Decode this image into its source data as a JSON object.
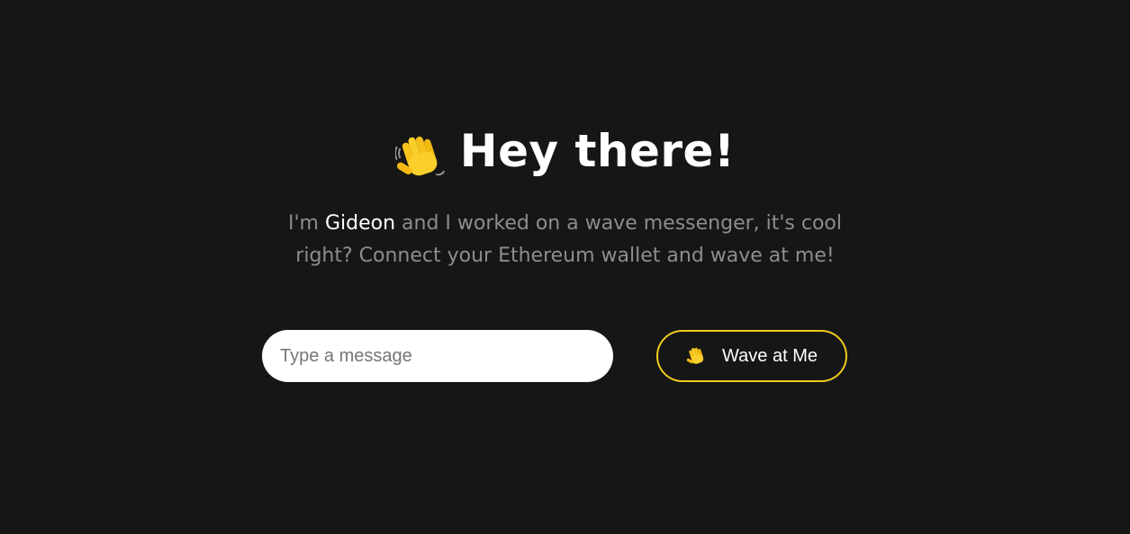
{
  "hero": {
    "title": "Hey there!",
    "title_icon": "waving-hand-icon",
    "subtitle_before": "I'm ",
    "subtitle_name": "Gideon",
    "subtitle_line1_after": " and I worked on a wave messenger, it's cool",
    "subtitle_line2": "right? Connect your Ethereum wallet and wave at me!"
  },
  "form": {
    "message_placeholder": "Type a message",
    "message_value": "",
    "wave_button_label": "Wave at Me",
    "wave_button_icon": "waving-hand-icon"
  },
  "colors": {
    "background": "#161616",
    "text_primary": "#ffffff",
    "text_muted": "#8d8d8d",
    "accent": "#f1cb1d",
    "input_background": "#ffffff"
  }
}
